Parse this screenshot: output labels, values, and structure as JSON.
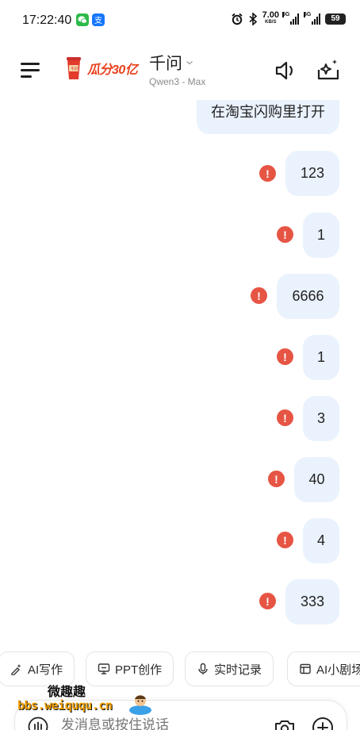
{
  "status_bar": {
    "time": "17:22:40",
    "speed_value": "7.00",
    "speed_unit": "KB/S",
    "sim1_tag": "5G",
    "sim2_tag": "5G",
    "battery": "59"
  },
  "header": {
    "promo_text": "瓜分30亿",
    "title": "千问",
    "model": "Qwen3 - Max"
  },
  "messages": [
    {
      "text": "在淘宝闪购里打开",
      "failed": false
    },
    {
      "text": "123",
      "failed": true
    },
    {
      "text": "1",
      "failed": true
    },
    {
      "text": "6666",
      "failed": true
    },
    {
      "text": "1",
      "failed": true
    },
    {
      "text": "3",
      "failed": true
    },
    {
      "text": "40",
      "failed": true
    },
    {
      "text": "4",
      "failed": true
    },
    {
      "text": "333",
      "failed": true
    }
  ],
  "error_glyph": "!",
  "quick_actions": [
    {
      "label": "AI写作",
      "icon": "pen-sparkle-icon"
    },
    {
      "label": "PPT创作",
      "icon": "presentation-icon"
    },
    {
      "label": "实时记录",
      "icon": "microphone-icon"
    },
    {
      "label": "AI小剧场",
      "icon": "theater-icon"
    }
  ],
  "input": {
    "placeholder": "发消息或按住说话"
  },
  "watermark": {
    "line1": "微趣趣",
    "line2": "bbs.weiququ.cn"
  },
  "colors": {
    "bubble": "#eaf2fd",
    "error": "#e65544",
    "promo": "#e8421e"
  }
}
